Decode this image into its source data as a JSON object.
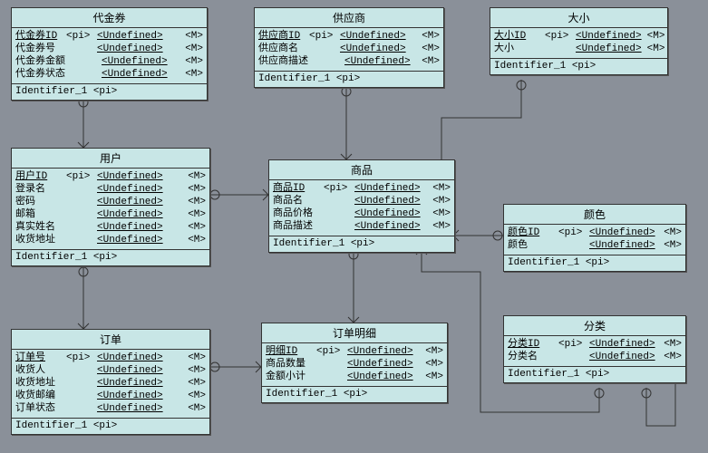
{
  "entities": {
    "voucher": {
      "title": "代金券",
      "attrs": [
        {
          "name": "代金券ID",
          "pk": true,
          "pi": "<pi>",
          "type": "<Undefined>",
          "m": "<M>"
        },
        {
          "name": "代金券号",
          "pk": false,
          "pi": "",
          "type": "<Undefined>",
          "m": "<M>"
        },
        {
          "name": "代金券金额",
          "pk": false,
          "pi": "",
          "type": "<Undefined>",
          "m": "<M>"
        },
        {
          "name": "代金券状态",
          "pk": false,
          "pi": "",
          "type": "<Undefined>",
          "m": "<M>"
        }
      ],
      "footer": "Identifier_1 <pi>"
    },
    "supplier": {
      "title": "供应商",
      "attrs": [
        {
          "name": "供应商ID",
          "pk": true,
          "pi": "<pi>",
          "type": "<Undefined>",
          "m": "<M>"
        },
        {
          "name": "供应商名",
          "pk": false,
          "pi": "",
          "type": "<Undefined>",
          "m": "<M>"
        },
        {
          "name": "供应商描述",
          "pk": false,
          "pi": "",
          "type": "<Undefined>",
          "m": "<M>"
        }
      ],
      "footer": "Identifier_1 <pi>"
    },
    "size": {
      "title": "大小",
      "attrs": [
        {
          "name": "大小ID",
          "pk": true,
          "pi": "<pi>",
          "type": "<Undefined>",
          "m": "<M>"
        },
        {
          "name": "大小",
          "pk": false,
          "pi": "",
          "type": "<Undefined>",
          "m": "<M>"
        }
      ],
      "footer": "Identifier_1 <pi>"
    },
    "user": {
      "title": "用户",
      "attrs": [
        {
          "name": "用户ID",
          "pk": true,
          "pi": "<pi>",
          "type": "<Undefined>",
          "m": "<M>"
        },
        {
          "name": "登录名",
          "pk": false,
          "pi": "",
          "type": "<Undefined>",
          "m": "<M>"
        },
        {
          "name": "密码",
          "pk": false,
          "pi": "",
          "type": "<Undefined>",
          "m": "<M>"
        },
        {
          "name": "邮箱",
          "pk": false,
          "pi": "",
          "type": "<Undefined>",
          "m": "<M>"
        },
        {
          "name": "真实姓名",
          "pk": false,
          "pi": "",
          "type": "<Undefined>",
          "m": "<M>"
        },
        {
          "name": "收货地址",
          "pk": false,
          "pi": "",
          "type": "<Undefined>",
          "m": "<M>"
        }
      ],
      "footer": "Identifier_1 <pi>"
    },
    "product": {
      "title": "商品",
      "attrs": [
        {
          "name": "商品ID",
          "pk": true,
          "pi": "<pi>",
          "type": "<Undefined>",
          "m": "<M>"
        },
        {
          "name": "商品名",
          "pk": false,
          "pi": "",
          "type": "<Undefined>",
          "m": "<M>"
        },
        {
          "name": "商品价格",
          "pk": false,
          "pi": "",
          "type": "<Undefined>",
          "m": "<M>"
        },
        {
          "name": "商品描述",
          "pk": false,
          "pi": "",
          "type": "<Undefined>",
          "m": "<M>"
        }
      ],
      "footer": "Identifier_1 <pi>"
    },
    "color": {
      "title": "颜色",
      "attrs": [
        {
          "name": "颜色ID",
          "pk": true,
          "pi": "<pi>",
          "type": "<Undefined>",
          "m": "<M>"
        },
        {
          "name": "颜色",
          "pk": false,
          "pi": "",
          "type": "<Undefined>",
          "m": "<M>"
        }
      ],
      "footer": "Identifier_1 <pi>"
    },
    "order": {
      "title": "订单",
      "attrs": [
        {
          "name": "订单号",
          "pk": true,
          "pi": "<pi>",
          "type": "<Undefined>",
          "m": "<M>"
        },
        {
          "name": "收货人",
          "pk": false,
          "pi": "",
          "type": "<Undefined>",
          "m": "<M>"
        },
        {
          "name": "收货地址",
          "pk": false,
          "pi": "",
          "type": "<Undefined>",
          "m": "<M>"
        },
        {
          "name": "收货邮编",
          "pk": false,
          "pi": "",
          "type": "<Undefined>",
          "m": "<M>"
        },
        {
          "name": "订单状态",
          "pk": false,
          "pi": "",
          "type": "<Undefined>",
          "m": "<M>"
        }
      ],
      "footer": "Identifier_1 <pi>"
    },
    "orderitem": {
      "title": "订单明细",
      "attrs": [
        {
          "name": "明细ID",
          "pk": true,
          "pi": "<pi>",
          "type": "<Undefined>",
          "m": "<M>"
        },
        {
          "name": "商品数量",
          "pk": false,
          "pi": "",
          "type": "<Undefined>",
          "m": "<M>"
        },
        {
          "name": "金额小计",
          "pk": false,
          "pi": "",
          "type": "<Undefined>",
          "m": "<M>"
        }
      ],
      "footer": "Identifier_1 <pi>"
    },
    "category": {
      "title": "分类",
      "attrs": [
        {
          "name": "分类ID",
          "pk": true,
          "pi": "<pi>",
          "type": "<Undefined>",
          "m": "<M>"
        },
        {
          "name": "分类名",
          "pk": false,
          "pi": "",
          "type": "<Undefined>",
          "m": "<M>"
        }
      ],
      "footer": "Identifier_1 <pi>"
    }
  },
  "watermark": ""
}
